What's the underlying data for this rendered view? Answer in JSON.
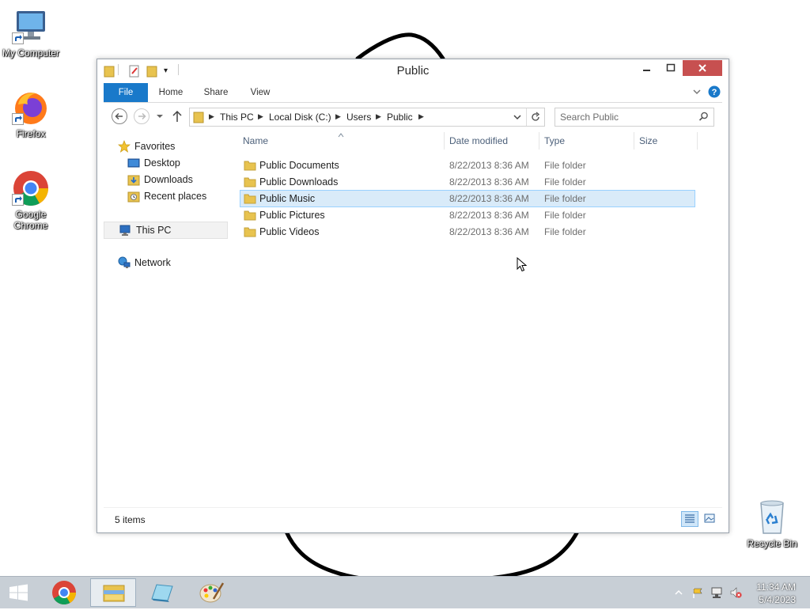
{
  "desktop": {
    "icons": [
      {
        "label": "My Computer"
      },
      {
        "label": "Firefox"
      },
      {
        "label": "Google Chrome"
      },
      {
        "label": "Recycle Bin"
      }
    ]
  },
  "window": {
    "title": "Public",
    "ribbon_tabs": [
      "File",
      "Home",
      "Share",
      "View"
    ],
    "breadcrumb": [
      "This PC",
      "Local Disk (C:)",
      "Users",
      "Public"
    ],
    "search": {
      "placeholder": "Search Public"
    },
    "nav": {
      "favorites": "Favorites",
      "desktop": "Desktop",
      "downloads": "Downloads",
      "recent": "Recent places",
      "this_pc": "This PC",
      "network": "Network"
    },
    "columns": [
      "Name",
      "Date modified",
      "Type",
      "Size"
    ],
    "files": [
      {
        "name": "Public Documents",
        "date": "8/22/2013 8:36 AM",
        "type": "File folder"
      },
      {
        "name": "Public Downloads",
        "date": "8/22/2013 8:36 AM",
        "type": "File folder"
      },
      {
        "name": "Public Music",
        "date": "8/22/2013 8:36 AM",
        "type": "File folder",
        "selected": true
      },
      {
        "name": "Public Pictures",
        "date": "8/22/2013 8:36 AM",
        "type": "File folder"
      },
      {
        "name": "Public Videos",
        "date": "8/22/2013 8:36 AM",
        "type": "File folder"
      }
    ],
    "status": "5 items"
  },
  "taskbar": {
    "time": "11:34 AM",
    "date": "5/4/2023"
  },
  "colors": {
    "file_tab": "#1979ca",
    "close_button": "#c75050",
    "selection_bg": "#d9ebf9",
    "selection_border": "#99d1ff",
    "taskbar": "#c8cfd6"
  }
}
